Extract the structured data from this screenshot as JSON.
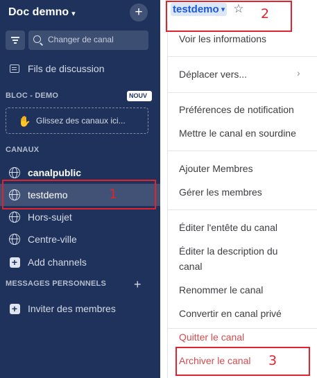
{
  "sidebar": {
    "team_name": "Doc demno",
    "team_chevron": "▾",
    "new_button": "+",
    "search_placeholder": "Changer de canal",
    "threads_label": "Fils de discussion",
    "bloc_label": "BLOC - DEMO",
    "new_badge": "NOUV",
    "drop_zone_text": "Glissez des canaux ici...",
    "channels_label": "CANAUX",
    "channels": [
      {
        "name": "canalpublic",
        "bold": true,
        "icon": "globe-icon"
      },
      {
        "name": "testdemo",
        "active": true,
        "icon": "globe-icon"
      },
      {
        "name": "Hors-sujet",
        "icon": "globe-icon"
      },
      {
        "name": "Centre-ville",
        "icon": "globe-icon"
      }
    ],
    "add_channels": "Add channels",
    "dm_label": "MESSAGES PERSONNELS",
    "dm_plus": "+",
    "invite_members": "Inviter des membres"
  },
  "header": {
    "channel_name": "testdemo",
    "chevron": "▾",
    "star": "☆"
  },
  "menu": {
    "items": [
      "Voir les informations",
      "Déplacer vers...",
      "Préférences de notification",
      "Mettre le canal en sourdine",
      "Ajouter Membres",
      "Gérer les membres",
      "Éditer l'entête du canal",
      "Éditer la description du",
      "canal",
      "Renommer le canal",
      "Convertir en canal privé",
      "Quitter le canal",
      "Archiver le canal"
    ],
    "submenu_arrow": "›"
  },
  "annotations": [
    "1",
    "2",
    "3"
  ],
  "colors": {
    "sidebar_bg": "#1e325c",
    "accent": "#1c58d9",
    "danger": "#d24b4e",
    "annotation": "#e0232c"
  }
}
